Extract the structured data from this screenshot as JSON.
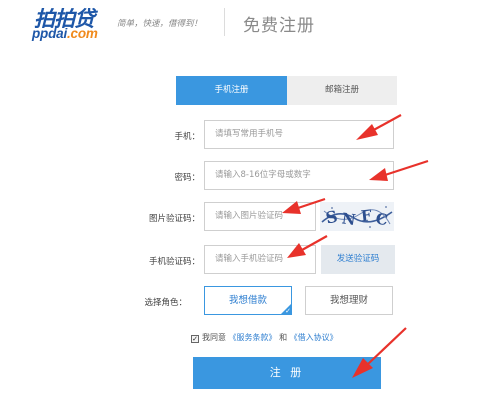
{
  "header": {
    "logo_cn": "拍拍贷",
    "logo_en_main": "ppdai",
    "logo_en_suffix": ".com",
    "slogan": "简单，快速，借得到！",
    "page_title": "免费注册"
  },
  "tabs": [
    {
      "label": "手机注册",
      "active": true
    },
    {
      "label": "邮箱注册",
      "active": false
    }
  ],
  "form": {
    "phone": {
      "label": "手机：",
      "placeholder": "请填写常用手机号"
    },
    "password": {
      "label": "密码：",
      "placeholder": "请输入8-16位字母或数字"
    },
    "image_code": {
      "label": "图片验证码：",
      "placeholder": "请输入图片验证码",
      "captcha_text": "SNFC"
    },
    "sms_code": {
      "label": "手机验证码：",
      "placeholder": "请输入手机验证码",
      "send_button": "发送验证码"
    },
    "role": {
      "label": "选择角色：",
      "options": [
        "我想借款",
        "我想理财"
      ],
      "selected": "我想借款"
    },
    "agreement": {
      "checked": true,
      "prefix": "我同意",
      "terms_link": "《服务条款》",
      "and": "和",
      "loan_link": "《借入协议》"
    },
    "submit_label": "注 册"
  },
  "colors": {
    "brand": "#1e57a8",
    "accent": "#3a97e0",
    "arrow": "#e8322b"
  }
}
